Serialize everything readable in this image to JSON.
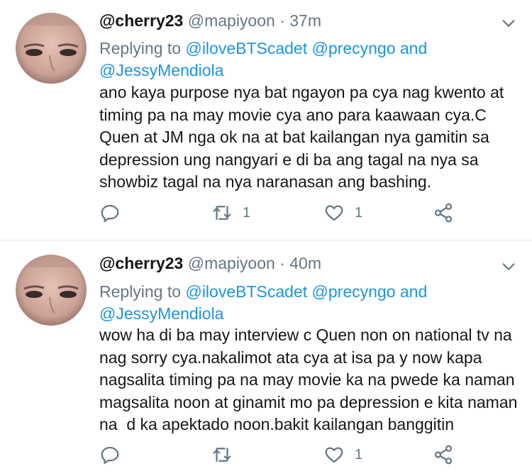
{
  "tweets": [
    {
      "name": "@cherry23",
      "handle": "@mapiyoon",
      "separator": "·",
      "time": "37m",
      "replying_prefix": "Replying to",
      "replying_to": [
        "@iloveBTScadet",
        "@precyngo",
        "and",
        "@JessyMendiola"
      ],
      "text": "ano kaya purpose nya bat ngayon pa cya nag kwento at timing pa na may movie cya ano para kaawaan cya.C Quen at JM nga ok na at bat kailangan nya gamitin sa depression ung nangyari e di ba ang tagal na nya sa showbiz tagal na nya naranasan ang bashing.",
      "actions": {
        "reply_count": "",
        "retweet_count": "1",
        "like_count": "1"
      }
    },
    {
      "name": "@cherry23",
      "handle": "@mapiyoon",
      "separator": "·",
      "time": "40m",
      "replying_prefix": "Replying to",
      "replying_to": [
        "@iloveBTScadet",
        "@precyngo",
        "and",
        "@JessyMendiola"
      ],
      "text": "wow ha di ba may interview c Quen non on national tv na nag sorry cya.nakalimot ata cya at isa pa y now kapa nagsalita timing pa na may movie ka na pwede ka naman magsalita noon at ginamit mo pa depression e kita naman na  d ka apektado noon.bakit kailangan banggitin",
      "actions": {
        "reply_count": "",
        "retweet_count": "",
        "like_count": "1"
      }
    }
  ],
  "icons": [
    "chevron-down-icon",
    "reply-icon",
    "retweet-icon",
    "like-icon",
    "share-icon"
  ],
  "colors": {
    "link": "#1b95e0",
    "secondary": "#657786",
    "text": "#14171a",
    "divider": "#e1e8ed"
  }
}
